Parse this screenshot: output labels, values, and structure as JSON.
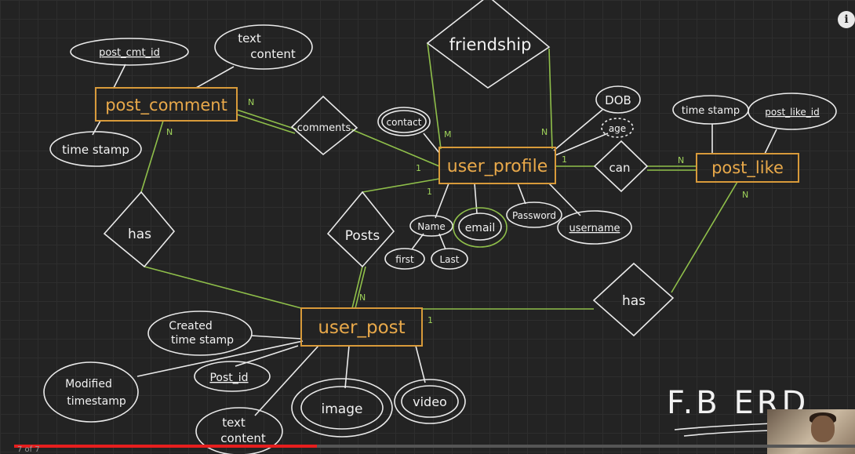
{
  "title": "F.B ERD",
  "entities": {
    "post_comment": "post_comment",
    "user_profile": "user_profile",
    "post_like": "post_like",
    "user_post": "user_post"
  },
  "relationships": {
    "friendship": "friendship",
    "comments": "comments",
    "can": "can",
    "has_left": "has",
    "posts": "Posts",
    "has_right": "has"
  },
  "attributes": {
    "post_cmt_id": "post_cmt_id",
    "text_content_1": "text",
    "text_content_2": "content",
    "time_stamp_comment": "time stamp",
    "contact": "contact",
    "dob": "DOB",
    "age": "age",
    "time_stamp_like": "time stamp",
    "post_like_id": "post_like_id",
    "name": "Name",
    "first": "first",
    "last": "Last",
    "email": "email",
    "password": "Password",
    "username": "username",
    "created_1": "Created",
    "created_2": "time stamp",
    "modified_1": "Modified",
    "modified_2": "timestamp",
    "post_id": "Post_id",
    "text_content_post_1": "text",
    "text_content_post_2": "content",
    "image": "image",
    "video": "video"
  },
  "cardinalities": {
    "pc_N_right": "N",
    "pc_N_down": "N",
    "up_M": "M",
    "up_N": "N",
    "up_1_left": "1",
    "up_1_right": "1",
    "up_1_down": "1",
    "pl_N_left": "N",
    "pl_N_down": "N",
    "post_N": "N",
    "post_1": "1"
  },
  "player": {
    "chapter": "7 of 7",
    "progress_percent": 36
  },
  "colors": {
    "entity": "#d89a3a",
    "relationship_line": "#8fbf4a",
    "ink": "#eaeaea",
    "background": "#232323"
  }
}
